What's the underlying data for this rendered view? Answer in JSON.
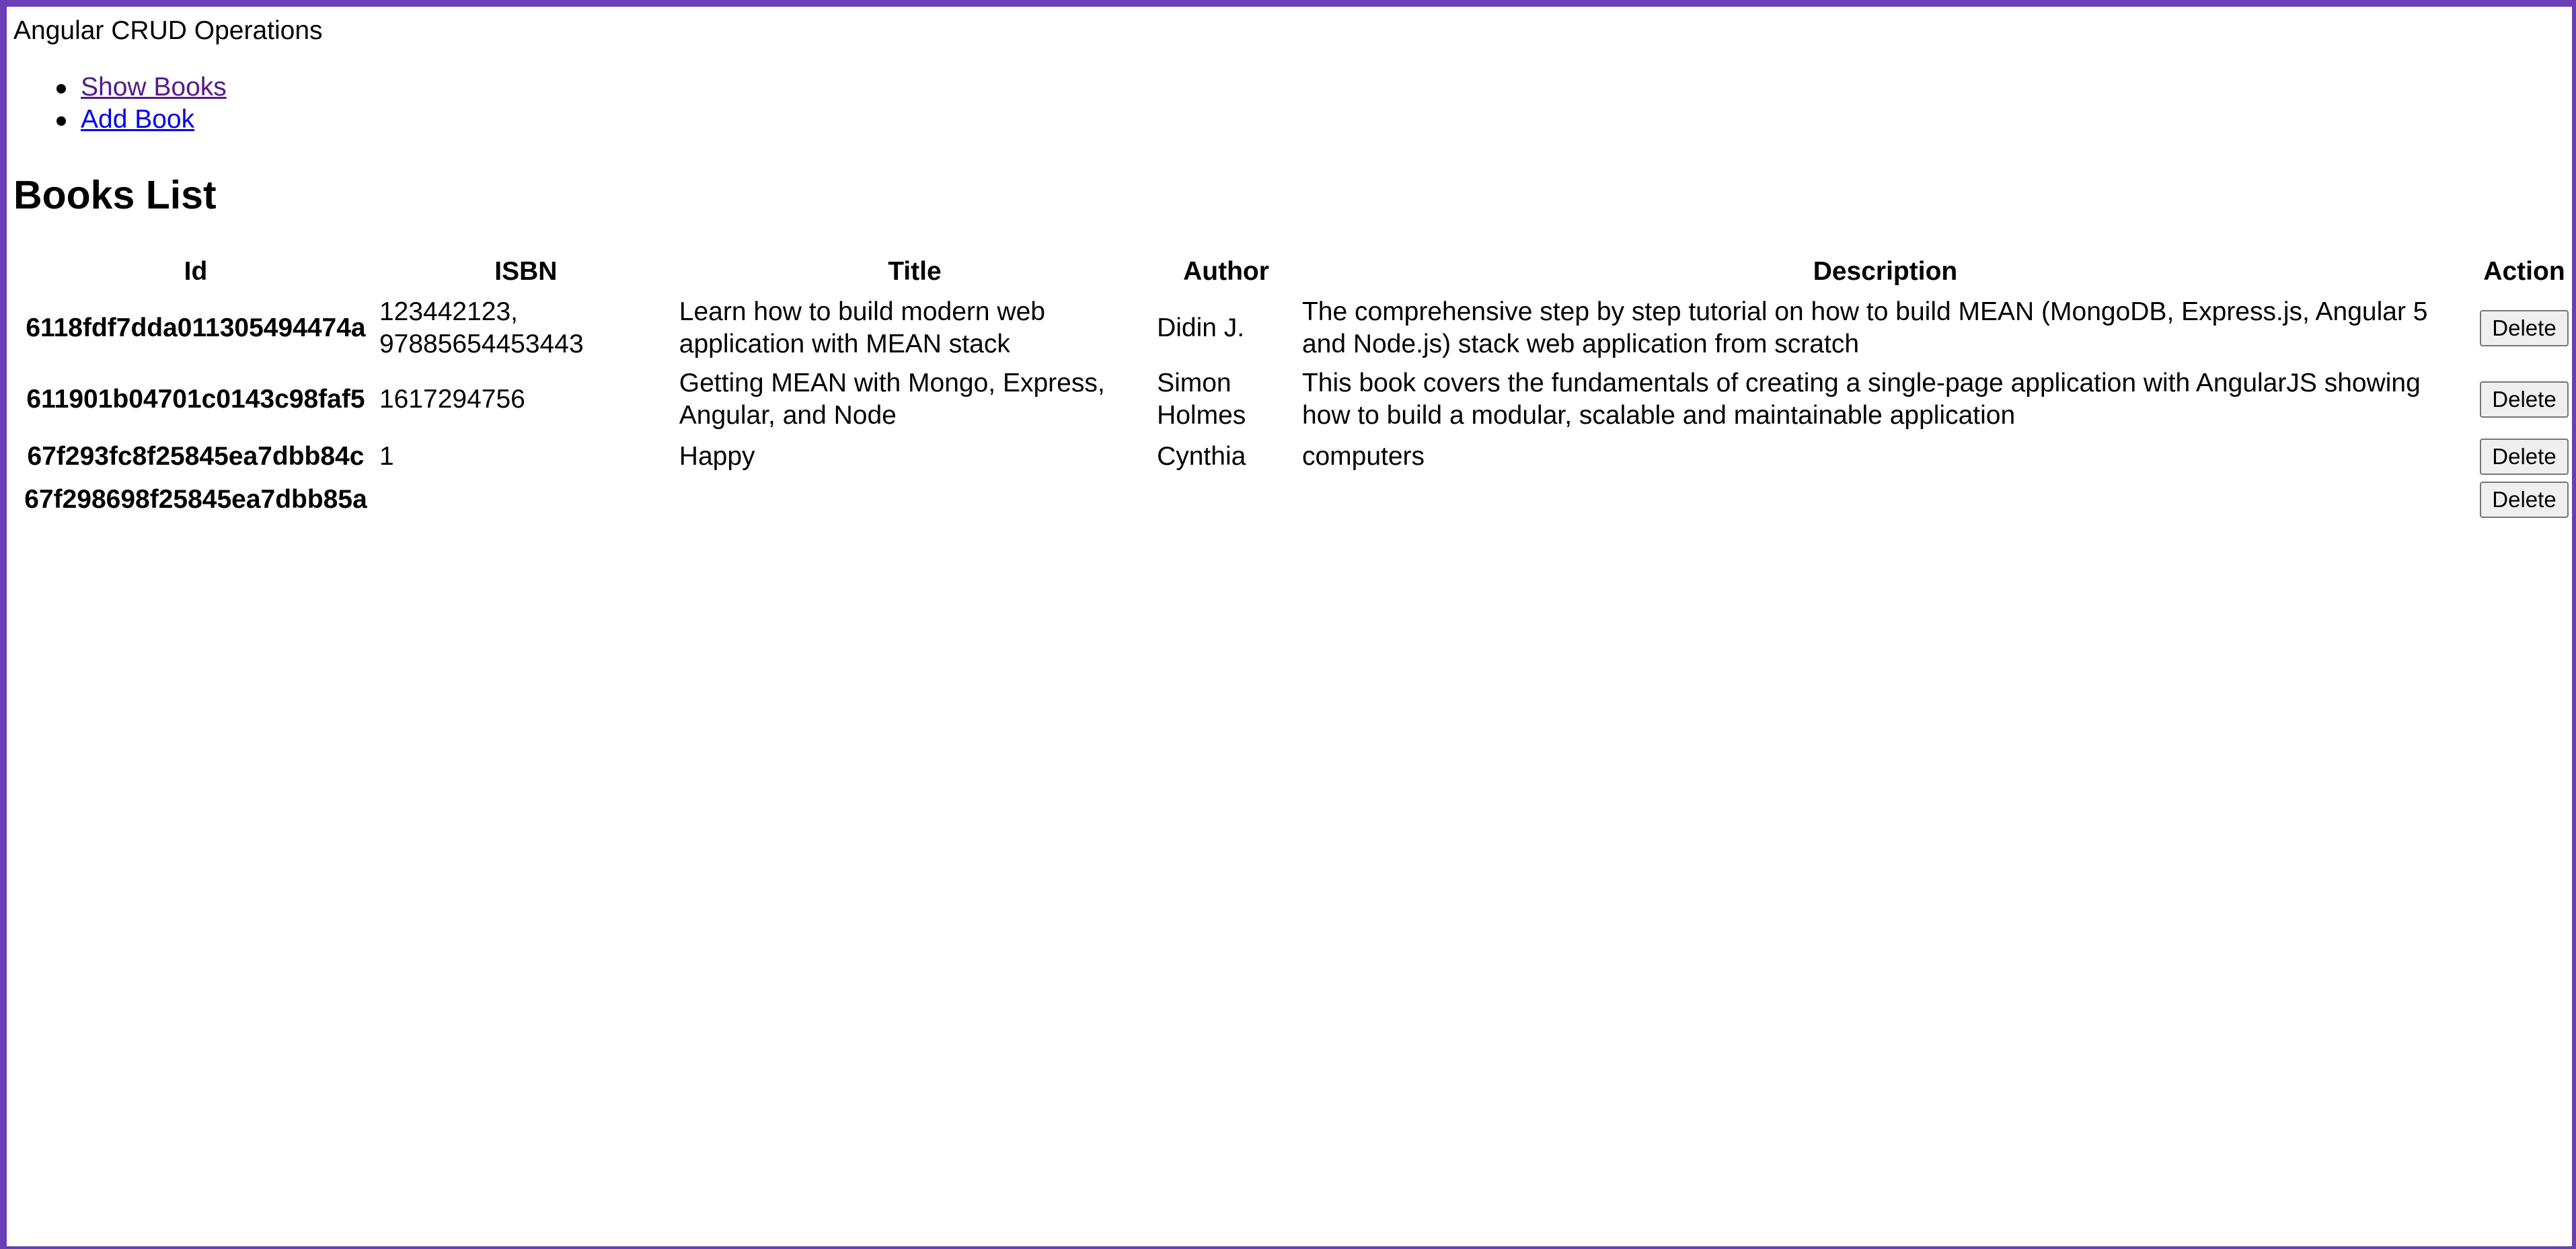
{
  "app": {
    "title": "Angular CRUD Operations"
  },
  "nav": {
    "items": [
      {
        "label": "Show Books",
        "state": "visited"
      },
      {
        "label": "Add Book",
        "state": "unvisited"
      }
    ]
  },
  "page": {
    "heading": "Books List"
  },
  "table": {
    "headers": {
      "id": "Id",
      "isbn": "ISBN",
      "title": "Title",
      "author": "Author",
      "description": "Description",
      "action": "Action"
    },
    "rows": [
      {
        "id": "6118fdf7dda011305494474a",
        "isbn": "123442123, 97885654453443",
        "title": "Learn how to build modern web application with MEAN stack",
        "author": "Didin J.",
        "description": "The comprehensive step by step tutorial on how to build MEAN (MongoDB, Express.js, Angular 5 and Node.js) stack web application from scratch",
        "action": "Delete"
      },
      {
        "id": "611901b04701c0143c98faf5",
        "isbn": "1617294756",
        "title": "Getting MEAN with Mongo, Express, Angular, and Node",
        "author": "Simon Holmes",
        "description": "This book covers the fundamentals of creating a single-page application with AngularJS showing how to build a modular, scalable and maintainable application",
        "action": "Delete"
      },
      {
        "id": "67f293fc8f25845ea7dbb84c",
        "isbn": "1",
        "title": "Happy",
        "author": "Cynthia",
        "description": "computers",
        "action": "Delete"
      },
      {
        "id": "67f298698f25845ea7dbb85a",
        "isbn": "",
        "title": "",
        "author": "",
        "description": "",
        "action": "Delete"
      }
    ]
  },
  "colors": {
    "frame": "#6a3fb5",
    "link_visited": "#551a8b",
    "link_unvisited": "#0000ee"
  }
}
